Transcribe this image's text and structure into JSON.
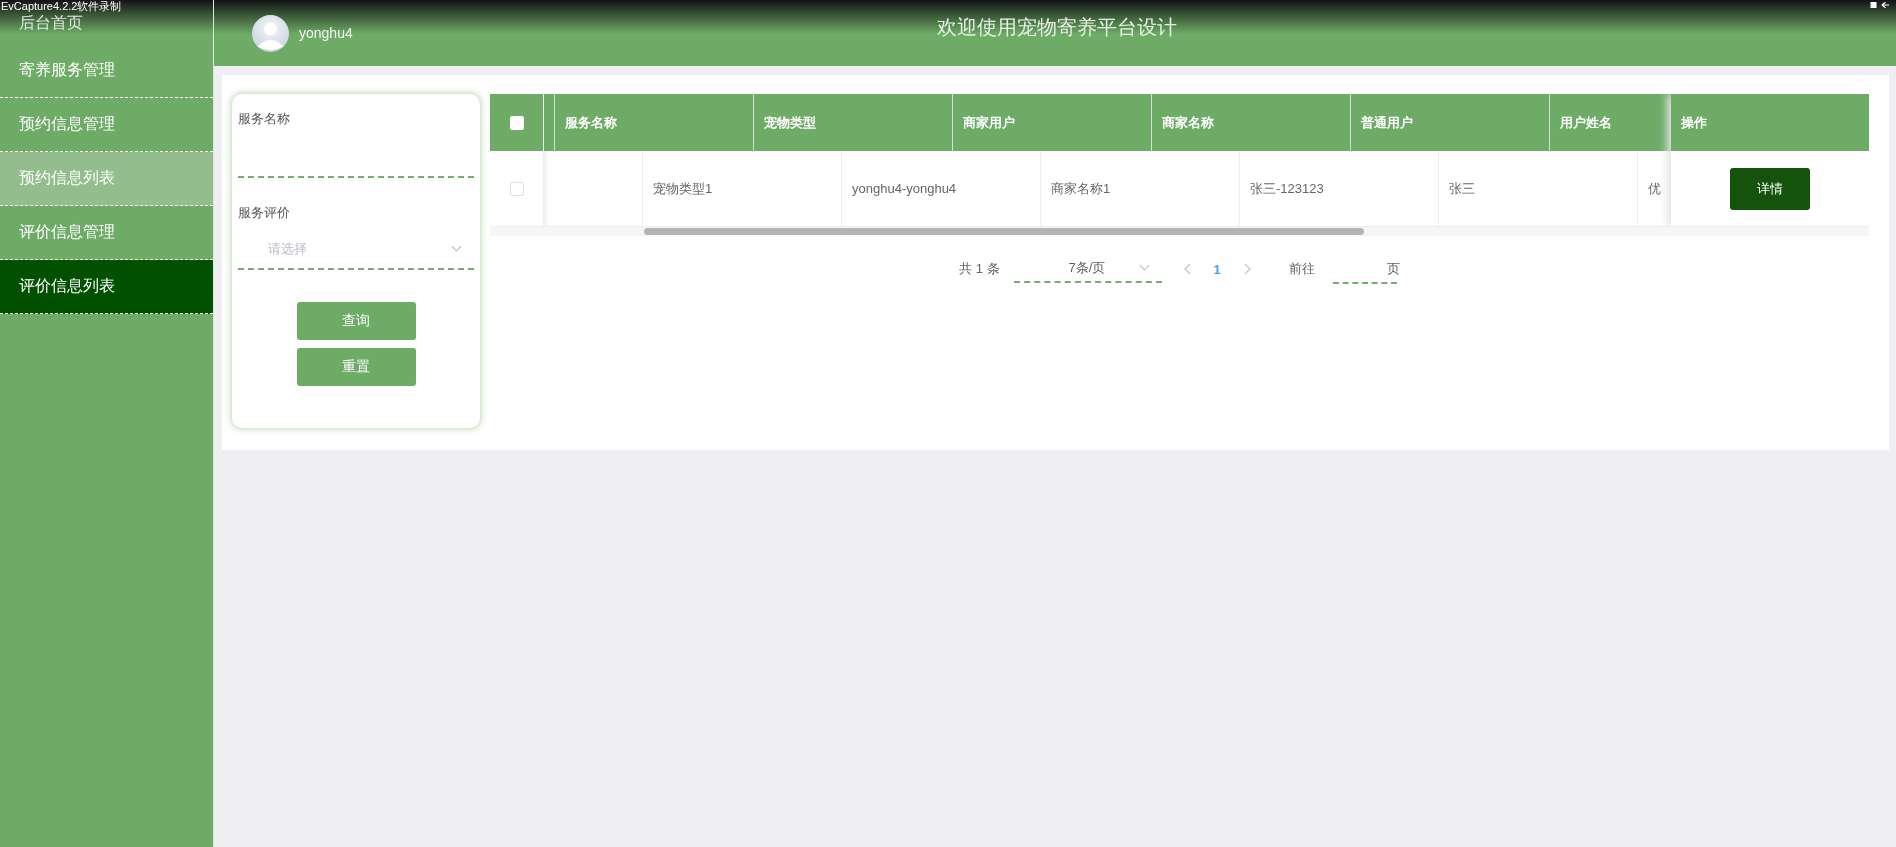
{
  "capture_bar": {
    "title": "EvCapture4.2.2软件录制"
  },
  "sidebar": {
    "items": [
      {
        "label": "后台首页",
        "selected": false,
        "hovered": false
      },
      {
        "label": "寄养服务管理",
        "selected": false,
        "hovered": false
      },
      {
        "label": "预约信息管理",
        "selected": false,
        "hovered": false
      },
      {
        "label": "预约信息列表",
        "selected": false,
        "hovered": true
      },
      {
        "label": "评价信息管理",
        "selected": false,
        "hovered": false
      },
      {
        "label": "评价信息列表",
        "selected": true,
        "hovered": false
      }
    ]
  },
  "header": {
    "username": "yonghu4",
    "title": "欢迎使用宠物寄养平台设计"
  },
  "search": {
    "fields": [
      {
        "kind": "text",
        "label": "服务名称"
      },
      {
        "kind": "select",
        "label": "服务评价",
        "placeholder": "请选择"
      }
    ],
    "buttons": [
      "查询",
      "重置"
    ]
  },
  "table": {
    "header_checked": false,
    "columns": [
      "服务名称",
      "宠物类型",
      "商家用户",
      "商家名称",
      "普通用户",
      "用户姓名"
    ],
    "action_column": "操作",
    "rows": [
      {
        "checked": false,
        "cells": [
          "",
          "宠物类型1",
          "yonghu4-yonghu4",
          "商家名称1",
          "张三-123123",
          "张三",
          "优"
        ],
        "action": "详情"
      }
    ]
  },
  "pagination": {
    "total": "共 1 条",
    "page_size": "7条/页",
    "pages": [
      {
        "label": "1",
        "selected": true
      }
    ],
    "goto": "前往",
    "page_unit": "页"
  }
}
